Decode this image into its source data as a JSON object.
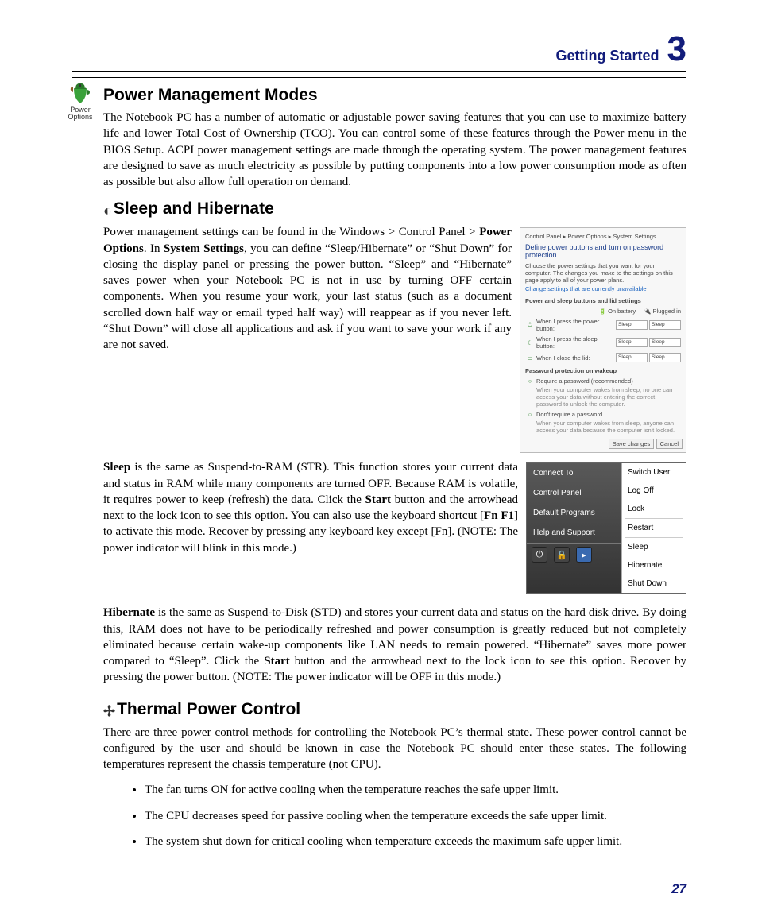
{
  "header": {
    "title": "Getting Started",
    "chapter": "3"
  },
  "s1": {
    "icon_label_l1": "Power",
    "icon_label_l2": "Options",
    "heading": "Power Management Modes",
    "para": "The Notebook PC has a number of automatic or adjustable power saving features that you can use to maximize battery life and lower Total Cost of Ownership (TCO). You can control some of these features through the Power menu in the BIOS Setup. ACPI power management settings are made through the operating system. The power management features are designed to save as much electricity as possible by putting components into a low power consumption mode as often as possible but also allow full operation on demand."
  },
  "s2": {
    "heading": "Sleep and Hibernate",
    "para1a": "Power management settings can be found in the Windows > Control Panel > ",
    "para1b": "Power Options",
    "para1c": ". In ",
    "para1d": "System Settings",
    "para1e": ", you can define “Sleep/Hibernate” or “Shut Down” for closing the display panel or pressing the power button. “Sleep” and “Hibernate” saves power when your Notebook PC is not in use by turning OFF certain components. When you resume your work, your last status (such as a document scrolled down half way or email typed half way) will reappear as if you never left. “Shut Down” will close all applications and ask if you want to save your work if any are not saved.",
    "para2a": "Sleep",
    "para2b": " is the same as Suspend-to-RAM (STR). This function stores your current data and status in RAM while many components are turned OFF. Because RAM is volatile, it requires power to keep (refresh) the data. Click the ",
    "para2c": "Start",
    "para2d": " button and the arrowhead next to the lock icon to see this option. You can also use the keyboard shortcut [",
    "para2e": "Fn F1",
    "para2f": "] to activate this mode. Recover by pressing any keyboard key except [Fn]. (NOTE: The power indicator will blink in this mode.)",
    "para3a": "Hibernate",
    "para3b": " is the same as  Suspend-to-Disk (STD) and stores your current data and status on the hard disk drive. By doing this, RAM does not have to be periodically refreshed and power consumption is greatly reduced but not completely eliminated because certain wake-up components like LAN needs to remain powered. “Hibernate” saves more power compared to “Sleep”. Click the ",
    "para3c": "Start",
    "para3d": " button and the arrowhead next to the lock icon to see this option. Recover by pressing the power button. (NOTE: The power indicator will be OFF in this mode.)"
  },
  "s3": {
    "heading": "Thermal Power Control",
    "intro": "There are three power control methods for controlling the Notebook PC’s thermal state. These power control cannot be configured by the user and should be known in case the Notebook PC should enter these states. The following temperatures represent the chassis temperature (not CPU).",
    "b1": "The fan turns ON for active cooling when the temperature reaches the safe upper limit.",
    "b2": "The CPU decreases speed for passive cooling when the temperature exceeds the safe upper limit.",
    "b3": "The system shut down for critical cooling when temperature exceeds the maximum safe upper limit."
  },
  "ss": {
    "crumb": "Control Panel ▸ Power Options ▸ System Settings",
    "title": "Define power buttons and turn on password protection",
    "sub": "Choose the power settings that you want for your computer. The changes you make to the settings on this page apply to all of your power plans.",
    "link": "Change settings that are currently unavailable",
    "sect1": "Power and sleep buttons and lid settings",
    "col1": "On battery",
    "col2": "Plugged in",
    "r1": "When I press the power button:",
    "r2": "When I press the sleep button:",
    "r3": "When I close the lid:",
    "sel": "Sleep",
    "sect2": "Password protection on wakeup",
    "opt1": "Require a password (recommended)",
    "opt1d": "When your computer wakes from sleep, no one can access your data without entering the correct password to unlock the computer.",
    "opt2": "Don't require a password",
    "opt2d": "When your computer wakes from sleep, anyone can access your data because the computer isn't locked.",
    "save": "Save changes",
    "cancel": "Cancel"
  },
  "sm": {
    "l1": "Connect To",
    "l2": "Control Panel",
    "l3": "Default Programs",
    "l4": "Help and Support",
    "r1": "Switch User",
    "r2": "Log Off",
    "r3": "Lock",
    "r4": "Restart",
    "r5": "Sleep",
    "r6": "Hibernate",
    "r7": "Shut Down"
  },
  "page_number": "27"
}
